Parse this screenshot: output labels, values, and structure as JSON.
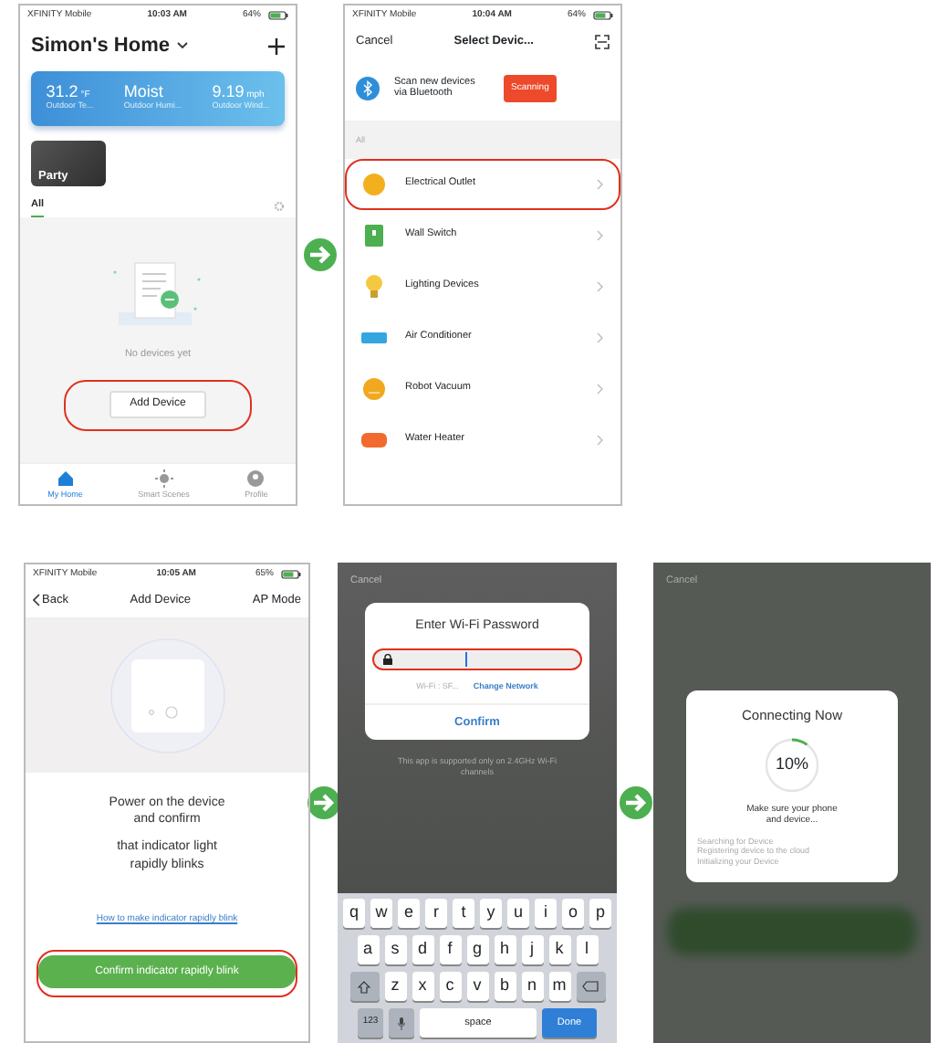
{
  "home_screen": {
    "status_bar": {
      "carrier": "XFINITY Mobile",
      "time": "10:03 AM",
      "battery": "64%"
    },
    "title": "Simon's Home",
    "weather": [
      {
        "value": "31.2",
        "unit": "°F",
        "label": "Outdoor Te..."
      },
      {
        "value": "Moist",
        "label": "Outdoor Humi..."
      },
      {
        "value": "9.19",
        "unit": "mph",
        "label": "Outdoor Wind..."
      }
    ],
    "scenes": [
      {
        "label": "Party"
      }
    ],
    "filter_tabs": [
      {
        "label": "All",
        "selected": true
      }
    ],
    "empty_text": "No devices yet",
    "add_button": {
      "label": "Add Device",
      "highlighted": true
    },
    "tab_bar": [
      {
        "label": "My Home",
        "selected": true
      },
      {
        "label": "Smart Scenes",
        "selected": false
      },
      {
        "label": "Profile",
        "selected": false
      }
    ]
  },
  "select_device_screen": {
    "status_bar": {
      "carrier": "XFINITY Mobile",
      "time": "10:04 AM",
      "battery": "64%"
    },
    "cancel": "Cancel",
    "title": "Select Devic...",
    "bluetooth_text": "Scan new devices via Bluetooth",
    "scan_button": "Scanning",
    "section": "All",
    "devices": [
      {
        "label": "Electrical Outlet",
        "kind": "outlet",
        "color": "#f2b01e",
        "highlighted": true
      },
      {
        "label": "Wall Switch",
        "kind": "switch",
        "color": "#4caf50",
        "highlighted": false
      },
      {
        "label": "Lighting Devices",
        "kind": "bulb",
        "color": "#f5c842",
        "highlighted": false
      },
      {
        "label": "Air Conditioner",
        "kind": "ac",
        "color": "#33a6e0",
        "highlighted": false
      },
      {
        "label": "Robot Vacuum",
        "kind": "vacuum",
        "color": "#f2a81e",
        "highlighted": false
      },
      {
        "label": "Water Heater",
        "kind": "heater",
        "color": "#f26a2e",
        "highlighted": false
      }
    ]
  },
  "ap_mode_screen": {
    "status_bar": {
      "carrier": "XFINITY Mobile",
      "time": "10:05 AM",
      "battery": "65%"
    },
    "back": "Back",
    "title": "Add Device",
    "mode": "AP Mode",
    "instructions": [
      "Power on the device and confirm",
      "that indicator light rapidly blinks"
    ],
    "help_link": "How to make indicator rapidly blink",
    "confirm_button": {
      "label": "Confirm indicator rapidly blink",
      "highlighted": true
    }
  },
  "wifi_password_screen": {
    "cancel": "Cancel",
    "dialog_title": "Enter Wi-Fi Password",
    "password_field_highlighted": true,
    "network": "Wi-Fi : SF...",
    "change_network": "Change Network",
    "confirm": "Confirm",
    "note": "This app is supported only on 2.4GHz Wi-Fi channels",
    "keyboard_rows": [
      [
        "q",
        "w",
        "e",
        "r",
        "t",
        "y",
        "u",
        "i",
        "o",
        "p"
      ],
      [
        "a",
        "s",
        "d",
        "f",
        "g",
        "h",
        "j",
        "k",
        "l"
      ],
      [
        "z",
        "x",
        "c",
        "v",
        "b",
        "n",
        "m"
      ]
    ],
    "numbers_key": "123",
    "space_key": "space",
    "done_key": "Done"
  },
  "connecting_screen": {
    "cancel": "Cancel",
    "title": "Connecting Now",
    "progress": {
      "level": 0.1,
      "percent": "10%"
    },
    "message": "Make sure your phone and device...",
    "steps": [
      "Searching for Device",
      "Registering device to the cloud",
      "Initializing your Device"
    ]
  }
}
